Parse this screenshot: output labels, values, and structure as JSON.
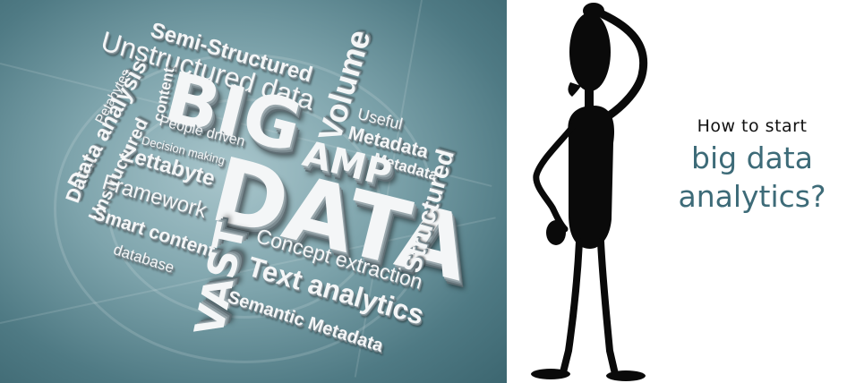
{
  "wordcloud": {
    "words": [
      "Semi-Structured",
      "Unstructured data",
      "Petabytes",
      "Data analysis",
      "content",
      "BIG",
      "Volume",
      "Useful",
      "Metadata",
      "Metadata",
      "People driven",
      "Decision making",
      "Unstructured",
      "Zettabyte",
      "Framework",
      "Data",
      "AMP",
      "DATA",
      "Smart content",
      "database",
      "Structured",
      "VAST",
      "Concept extraction",
      "Text analytics",
      "Semantic Metadata"
    ]
  },
  "caption": {
    "line1": "How to start",
    "line2": "big data",
    "line3": "analytics?"
  },
  "colors": {
    "accent": "#3d6b78",
    "figure": "#0a0a0a",
    "background": "#ffffff"
  },
  "icons": {
    "figure": "thinking-stick-figure-icon"
  }
}
